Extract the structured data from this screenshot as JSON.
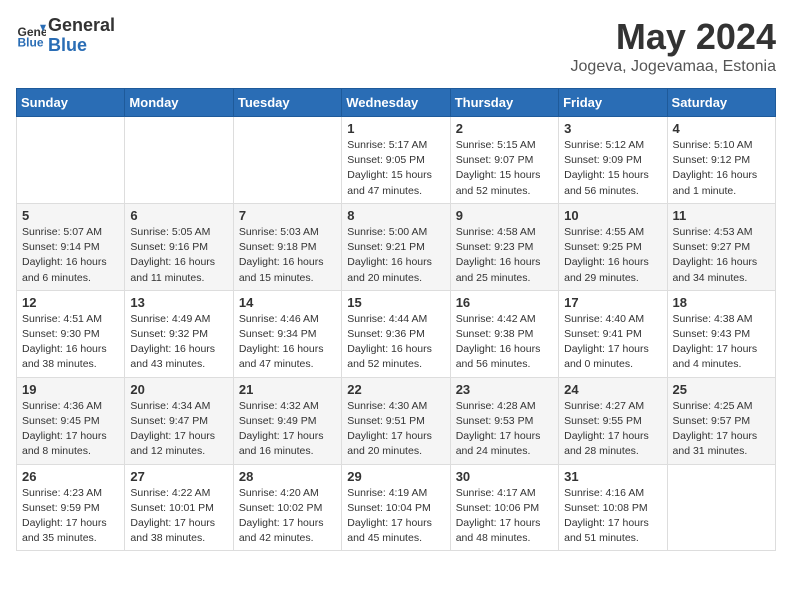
{
  "header": {
    "logo_general": "General",
    "logo_blue": "Blue",
    "title": "May 2024",
    "location": "Jogeva, Jogevamaa, Estonia"
  },
  "weekdays": [
    "Sunday",
    "Monday",
    "Tuesday",
    "Wednesday",
    "Thursday",
    "Friday",
    "Saturday"
  ],
  "weeks": [
    [
      {
        "day": "",
        "sunrise": "",
        "sunset": "",
        "daylight": ""
      },
      {
        "day": "",
        "sunrise": "",
        "sunset": "",
        "daylight": ""
      },
      {
        "day": "",
        "sunrise": "",
        "sunset": "",
        "daylight": ""
      },
      {
        "day": "1",
        "sunrise": "Sunrise: 5:17 AM",
        "sunset": "Sunset: 9:05 PM",
        "daylight": "Daylight: 15 hours and 47 minutes."
      },
      {
        "day": "2",
        "sunrise": "Sunrise: 5:15 AM",
        "sunset": "Sunset: 9:07 PM",
        "daylight": "Daylight: 15 hours and 52 minutes."
      },
      {
        "day": "3",
        "sunrise": "Sunrise: 5:12 AM",
        "sunset": "Sunset: 9:09 PM",
        "daylight": "Daylight: 15 hours and 56 minutes."
      },
      {
        "day": "4",
        "sunrise": "Sunrise: 5:10 AM",
        "sunset": "Sunset: 9:12 PM",
        "daylight": "Daylight: 16 hours and 1 minute."
      }
    ],
    [
      {
        "day": "5",
        "sunrise": "Sunrise: 5:07 AM",
        "sunset": "Sunset: 9:14 PM",
        "daylight": "Daylight: 16 hours and 6 minutes."
      },
      {
        "day": "6",
        "sunrise": "Sunrise: 5:05 AM",
        "sunset": "Sunset: 9:16 PM",
        "daylight": "Daylight: 16 hours and 11 minutes."
      },
      {
        "day": "7",
        "sunrise": "Sunrise: 5:03 AM",
        "sunset": "Sunset: 9:18 PM",
        "daylight": "Daylight: 16 hours and 15 minutes."
      },
      {
        "day": "8",
        "sunrise": "Sunrise: 5:00 AM",
        "sunset": "Sunset: 9:21 PM",
        "daylight": "Daylight: 16 hours and 20 minutes."
      },
      {
        "day": "9",
        "sunrise": "Sunrise: 4:58 AM",
        "sunset": "Sunset: 9:23 PM",
        "daylight": "Daylight: 16 hours and 25 minutes."
      },
      {
        "day": "10",
        "sunrise": "Sunrise: 4:55 AM",
        "sunset": "Sunset: 9:25 PM",
        "daylight": "Daylight: 16 hours and 29 minutes."
      },
      {
        "day": "11",
        "sunrise": "Sunrise: 4:53 AM",
        "sunset": "Sunset: 9:27 PM",
        "daylight": "Daylight: 16 hours and 34 minutes."
      }
    ],
    [
      {
        "day": "12",
        "sunrise": "Sunrise: 4:51 AM",
        "sunset": "Sunset: 9:30 PM",
        "daylight": "Daylight: 16 hours and 38 minutes."
      },
      {
        "day": "13",
        "sunrise": "Sunrise: 4:49 AM",
        "sunset": "Sunset: 9:32 PM",
        "daylight": "Daylight: 16 hours and 43 minutes."
      },
      {
        "day": "14",
        "sunrise": "Sunrise: 4:46 AM",
        "sunset": "Sunset: 9:34 PM",
        "daylight": "Daylight: 16 hours and 47 minutes."
      },
      {
        "day": "15",
        "sunrise": "Sunrise: 4:44 AM",
        "sunset": "Sunset: 9:36 PM",
        "daylight": "Daylight: 16 hours and 52 minutes."
      },
      {
        "day": "16",
        "sunrise": "Sunrise: 4:42 AM",
        "sunset": "Sunset: 9:38 PM",
        "daylight": "Daylight: 16 hours and 56 minutes."
      },
      {
        "day": "17",
        "sunrise": "Sunrise: 4:40 AM",
        "sunset": "Sunset: 9:41 PM",
        "daylight": "Daylight: 17 hours and 0 minutes."
      },
      {
        "day": "18",
        "sunrise": "Sunrise: 4:38 AM",
        "sunset": "Sunset: 9:43 PM",
        "daylight": "Daylight: 17 hours and 4 minutes."
      }
    ],
    [
      {
        "day": "19",
        "sunrise": "Sunrise: 4:36 AM",
        "sunset": "Sunset: 9:45 PM",
        "daylight": "Daylight: 17 hours and 8 minutes."
      },
      {
        "day": "20",
        "sunrise": "Sunrise: 4:34 AM",
        "sunset": "Sunset: 9:47 PM",
        "daylight": "Daylight: 17 hours and 12 minutes."
      },
      {
        "day": "21",
        "sunrise": "Sunrise: 4:32 AM",
        "sunset": "Sunset: 9:49 PM",
        "daylight": "Daylight: 17 hours and 16 minutes."
      },
      {
        "day": "22",
        "sunrise": "Sunrise: 4:30 AM",
        "sunset": "Sunset: 9:51 PM",
        "daylight": "Daylight: 17 hours and 20 minutes."
      },
      {
        "day": "23",
        "sunrise": "Sunrise: 4:28 AM",
        "sunset": "Sunset: 9:53 PM",
        "daylight": "Daylight: 17 hours and 24 minutes."
      },
      {
        "day": "24",
        "sunrise": "Sunrise: 4:27 AM",
        "sunset": "Sunset: 9:55 PM",
        "daylight": "Daylight: 17 hours and 28 minutes."
      },
      {
        "day": "25",
        "sunrise": "Sunrise: 4:25 AM",
        "sunset": "Sunset: 9:57 PM",
        "daylight": "Daylight: 17 hours and 31 minutes."
      }
    ],
    [
      {
        "day": "26",
        "sunrise": "Sunrise: 4:23 AM",
        "sunset": "Sunset: 9:59 PM",
        "daylight": "Daylight: 17 hours and 35 minutes."
      },
      {
        "day": "27",
        "sunrise": "Sunrise: 4:22 AM",
        "sunset": "Sunset: 10:01 PM",
        "daylight": "Daylight: 17 hours and 38 minutes."
      },
      {
        "day": "28",
        "sunrise": "Sunrise: 4:20 AM",
        "sunset": "Sunset: 10:02 PM",
        "daylight": "Daylight: 17 hours and 42 minutes."
      },
      {
        "day": "29",
        "sunrise": "Sunrise: 4:19 AM",
        "sunset": "Sunset: 10:04 PM",
        "daylight": "Daylight: 17 hours and 45 minutes."
      },
      {
        "day": "30",
        "sunrise": "Sunrise: 4:17 AM",
        "sunset": "Sunset: 10:06 PM",
        "daylight": "Daylight: 17 hours and 48 minutes."
      },
      {
        "day": "31",
        "sunrise": "Sunrise: 4:16 AM",
        "sunset": "Sunset: 10:08 PM",
        "daylight": "Daylight: 17 hours and 51 minutes."
      },
      {
        "day": "",
        "sunrise": "",
        "sunset": "",
        "daylight": ""
      }
    ]
  ]
}
